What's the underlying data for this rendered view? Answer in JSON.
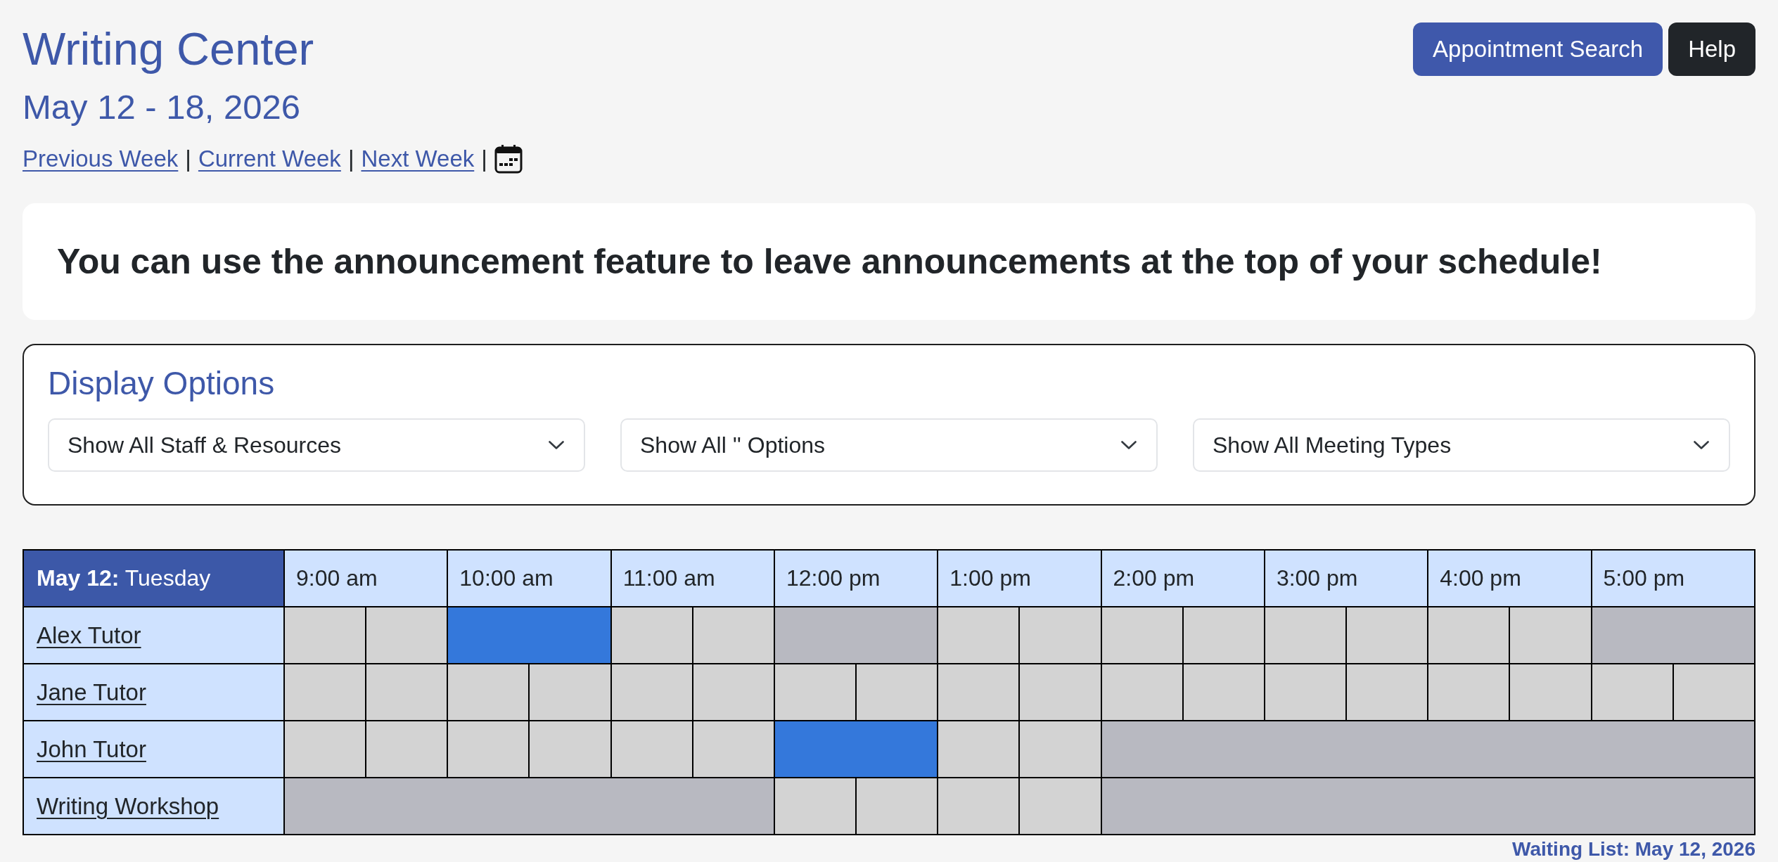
{
  "header": {
    "title": "Writing Center",
    "date_range": "May 12 - 18, 2026",
    "week_links": [
      {
        "label": "Previous Week",
        "separator": "|"
      },
      {
        "label": "Current Week",
        "separator": "|"
      },
      {
        "label": "Next Week",
        "separator": "|"
      }
    ]
  },
  "buttons": [
    {
      "label": "Appointment Search",
      "kind": "primary"
    },
    {
      "label": "Help",
      "kind": "dark"
    }
  ],
  "announcement": "You can use the announcement feature to leave announcements at the top of your schedule!",
  "display_options": {
    "title": "Display Options",
    "selects": [
      {
        "value": "Show All Staff & Resources"
      },
      {
        "value": "Show All '' Options"
      },
      {
        "value": "Show All Meeting Types"
      }
    ]
  },
  "schedule": {
    "day_heading": "**May 12:** Tuesday",
    "hours": [
      "9:00 am",
      "10:00 am",
      "11:00 am",
      "12:00 pm",
      "1:00 pm",
      "2:00 pm",
      "3:00 pm",
      "4:00 pm",
      "5:00 pm"
    ],
    "rows": [
      {
        "name": "Alex Tutor",
        "slots": [
          {
            "kind": "open"
          },
          {
            "kind": "open"
          },
          {
            "kind": "booked"
          },
          {
            "kind": "booked"
          },
          {
            "kind": "open"
          },
          {
            "kind": "open"
          },
          {
            "kind": "unavailable"
          },
          {
            "kind": "unavailable"
          },
          {
            "kind": "open"
          },
          {
            "kind": "open"
          },
          {
            "kind": "open"
          },
          {
            "kind": "open"
          },
          {
            "kind": "open"
          },
          {
            "kind": "open"
          },
          {
            "kind": "open"
          },
          {
            "kind": "open"
          },
          {
            "kind": "unavailable"
          },
          {
            "kind": "unavailable"
          }
        ]
      },
      {
        "name": "Jane Tutor",
        "slots": [
          {
            "kind": "open"
          },
          {
            "kind": "open"
          },
          {
            "kind": "open"
          },
          {
            "kind": "open"
          },
          {
            "kind": "open"
          },
          {
            "kind": "open"
          },
          {
            "kind": "open"
          },
          {
            "kind": "open"
          },
          {
            "kind": "open"
          },
          {
            "kind": "open"
          },
          {
            "kind": "open"
          },
          {
            "kind": "open"
          },
          {
            "kind": "open"
          },
          {
            "kind": "open"
          },
          {
            "kind": "open"
          },
          {
            "kind": "open"
          },
          {
            "kind": "open"
          },
          {
            "kind": "open"
          }
        ]
      },
      {
        "name": "John Tutor",
        "slots": [
          {
            "kind": "open"
          },
          {
            "kind": "open"
          },
          {
            "kind": "open"
          },
          {
            "kind": "open"
          },
          {
            "kind": "open"
          },
          {
            "kind": "open"
          },
          {
            "kind": "booked"
          },
          {
            "kind": "booked"
          },
          {
            "kind": "open"
          },
          {
            "kind": "open"
          },
          {
            "kind": "unavailable"
          },
          {
            "kind": "unavailable"
          },
          {
            "kind": "unavailable"
          },
          {
            "kind": "unavailable"
          },
          {
            "kind": "unavailable"
          },
          {
            "kind": "unavailable"
          },
          {
            "kind": "unavailable"
          },
          {
            "kind": "unavailable"
          }
        ]
      },
      {
        "name": "Writing Workshop",
        "slots": [
          {
            "kind": "unavailable"
          },
          {
            "kind": "unavailable"
          },
          {
            "kind": "unavailable"
          },
          {
            "kind": "unavailable"
          },
          {
            "kind": "unavailable"
          },
          {
            "kind": "unavailable"
          },
          {
            "kind": "open"
          },
          {
            "kind": "open"
          },
          {
            "kind": "open"
          },
          {
            "kind": "open"
          },
          {
            "kind": "unavailable"
          },
          {
            "kind": "unavailable"
          },
          {
            "kind": "unavailable"
          },
          {
            "kind": "unavailable"
          },
          {
            "kind": "unavailable"
          },
          {
            "kind": "unavailable"
          },
          {
            "kind": "unavailable"
          },
          {
            "kind": "unavailable"
          }
        ]
      }
    ]
  },
  "waiting_list": "Waiting List: May 12, 2026"
}
